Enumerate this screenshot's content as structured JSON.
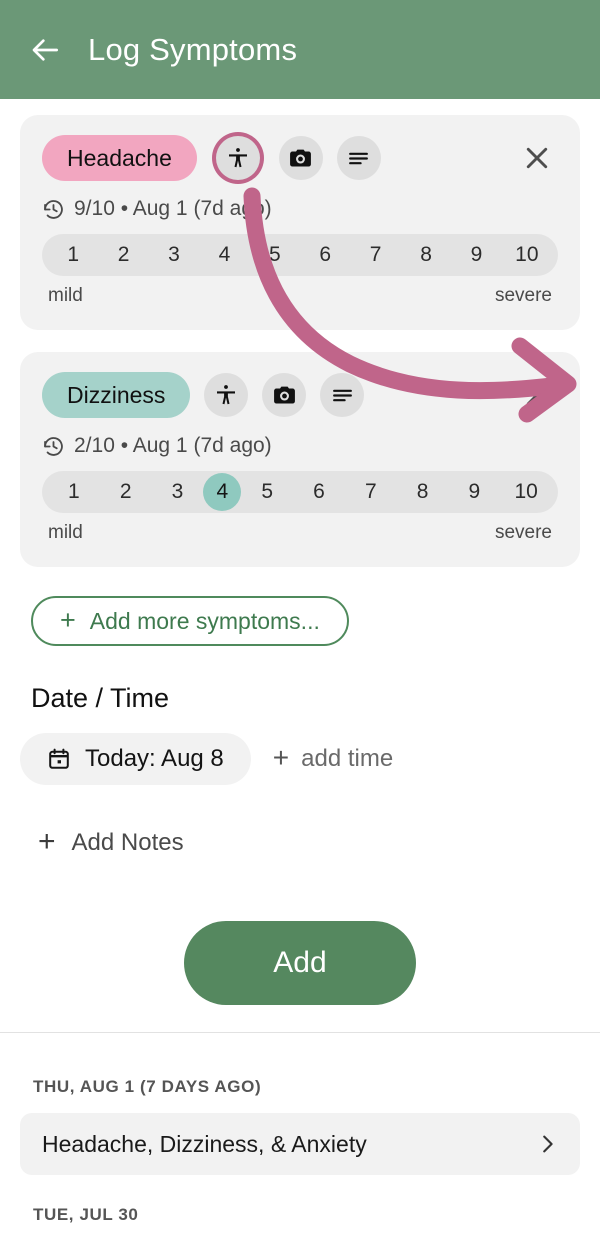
{
  "header": {
    "title": "Log Symptoms",
    "back_icon": "arrow-left-icon",
    "bg_color": "#6B9877"
  },
  "theme": {
    "green": "#55885F",
    "green_outline": "#4F8A5C",
    "pink_pill": "#F2A6C0",
    "teal_pill": "#A5D2CA",
    "teal_select": "#8FC9BF",
    "annotation": "#C0658A",
    "card_bg": "#F2F2F2",
    "scale_bg": "#E3E3E3"
  },
  "symptom_cards": [
    {
      "name": "Headache",
      "pill_color": "#F2A6C0",
      "history_icon": "history-icon",
      "history_text": "9/10 • Aug 1 (7d ago)",
      "actions": [
        "body-map-icon",
        "camera-icon",
        "notes-icon"
      ],
      "highlighted_action": "body-map-icon",
      "close_icon": "close-icon",
      "scale": [
        "1",
        "2",
        "3",
        "4",
        "5",
        "6",
        "7",
        "8",
        "9",
        "10"
      ],
      "selected": null,
      "low_label": "mild",
      "high_label": "severe"
    },
    {
      "name": "Dizziness",
      "pill_color": "#A5D2CA",
      "history_icon": "history-icon",
      "history_text": "2/10 • Aug 1 (7d ago)",
      "actions": [
        "body-map-icon",
        "camera-icon",
        "notes-icon"
      ],
      "highlighted_action": null,
      "close_icon": "close-icon",
      "scale": [
        "1",
        "2",
        "3",
        "4",
        "5",
        "6",
        "7",
        "8",
        "9",
        "10"
      ],
      "selected": "4",
      "low_label": "mild",
      "high_label": "severe"
    }
  ],
  "add_more": {
    "label": "Add more symptoms...",
    "plus": "+"
  },
  "date_time": {
    "section_title": "Date / Time",
    "date_chip": {
      "icon": "calendar-icon",
      "label": "Today: Aug 8"
    },
    "add_time": {
      "plus": "+",
      "label": "add time"
    }
  },
  "notes": {
    "plus": "+",
    "label": "Add Notes"
  },
  "submit": {
    "label": "Add"
  },
  "history": [
    {
      "date_header": "THU, AUG 1 (7 DAYS AGO)",
      "entry": "Headache, Dizziness, & Anxiety",
      "chevron": "chevron-right-icon"
    },
    {
      "date_header": "TUE, JUL 30",
      "entry": null,
      "chevron": null
    }
  ],
  "annotation": {
    "type": "curved-arrow",
    "color": "#C0658A",
    "from": "body-map-icon on Headache card",
    "to": "right side of Dizziness card"
  }
}
